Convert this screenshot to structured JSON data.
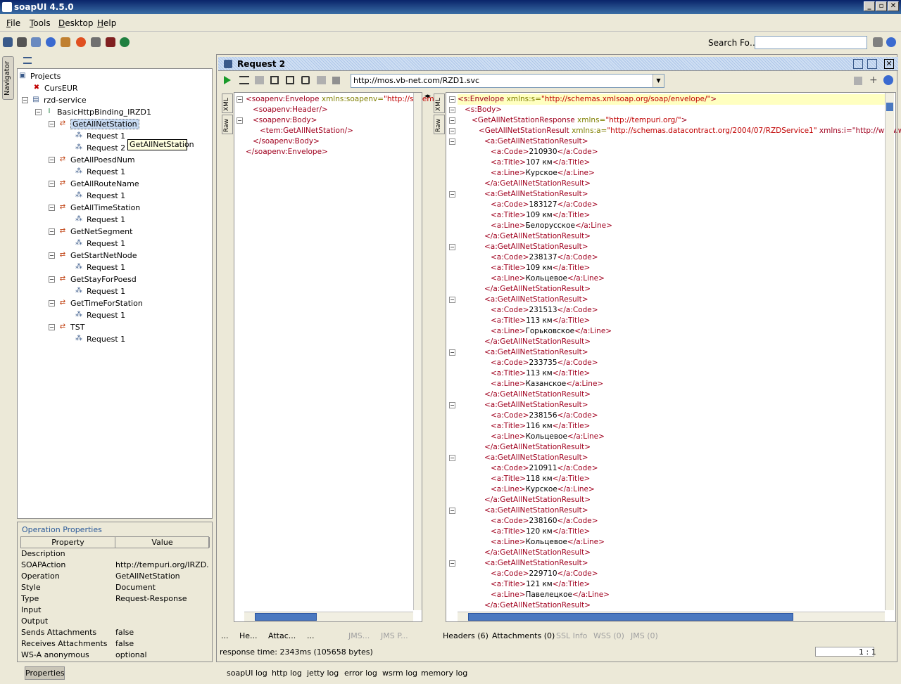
{
  "window": {
    "title": "soapUI 4.5.0"
  },
  "menu": [
    "File",
    "Tools",
    "Desktop",
    "Help"
  ],
  "toolbar": {
    "search_label": "Search Fo…"
  },
  "navigator_tab": "Navigator",
  "tree": {
    "root": "Projects",
    "projects": [
      {
        "name": "CursEUR"
      },
      {
        "name": "rzd-service"
      }
    ],
    "binding": "BasicHttpBinding_IRZD1",
    "operations": [
      {
        "name": "GetAllNetStation",
        "requests": [
          "Request 1",
          "Request 2"
        ]
      },
      {
        "name": "GetAllPoesdNum",
        "requests": [
          "Request 1"
        ]
      },
      {
        "name": "GetAllRouteName",
        "requests": [
          "Request 1"
        ]
      },
      {
        "name": "GetAllTimeStation",
        "requests": [
          "Request 1"
        ]
      },
      {
        "name": "GetNetSegment",
        "requests": [
          "Request 1"
        ]
      },
      {
        "name": "GetStartNetNode",
        "requests": [
          "Request 1"
        ]
      },
      {
        "name": "GetStayForPoesd",
        "requests": [
          "Request 1"
        ]
      },
      {
        "name": "GetTimeForStation",
        "requests": [
          "Request 1"
        ]
      },
      {
        "name": "TST",
        "requests": [
          "Request 1"
        ]
      }
    ],
    "tooltip": "GetAllNetStation"
  },
  "properties": {
    "title": "Operation Properties",
    "col_property": "Property",
    "col_value": "Value",
    "rows": [
      [
        "Description",
        ""
      ],
      [
        "SOAPAction",
        "http://tempuri.org/IRZD..."
      ],
      [
        "Operation",
        "GetAllNetStation"
      ],
      [
        "Style",
        "Document"
      ],
      [
        "Type",
        "Request-Response"
      ],
      [
        "Input",
        ""
      ],
      [
        "Output",
        ""
      ],
      [
        "Sends Attachments",
        "false"
      ],
      [
        "Receives Attachments",
        "false"
      ],
      [
        "WS-A anonymous",
        "optional"
      ]
    ],
    "button": "Properties"
  },
  "request": {
    "title": "Request 2",
    "url": "http://mos.vb-net.com/RZD1.svc",
    "side_tabs": [
      "XML",
      "Raw"
    ],
    "lines": [
      {
        "indent": 0,
        "tag": "<soapenv:Envelope",
        "an": " xmlns:soapenv=",
        "av": "\"http://schem",
        "end": ""
      },
      {
        "indent": 1,
        "tag": "<soapenv:Header/>",
        "an": "",
        "av": "",
        "end": ""
      },
      {
        "indent": 1,
        "tag": "<soapenv:Body>",
        "an": "",
        "av": "",
        "end": ""
      },
      {
        "indent": 2,
        "tag": "<tem:GetAllNetStation/>",
        "an": "",
        "av": "",
        "end": ""
      },
      {
        "indent": 1,
        "tag": "</soapenv:Body>",
        "an": "",
        "av": "",
        "end": ""
      },
      {
        "indent": 0,
        "tag": "</soapenv:Envelope>",
        "an": "",
        "av": "",
        "end": ""
      }
    ],
    "bottom_tabs": [
      "...",
      "He...",
      "Attac...",
      "...",
      "JMS...",
      "JMS P..."
    ]
  },
  "response": {
    "header_lines": [
      {
        "indent": 0,
        "tag": "<s:Envelope",
        "an": " xmlns:s=",
        "av": "\"http://schemas.xmlsoap.org/soap/envelope/\"",
        "end": ">"
      },
      {
        "indent": 1,
        "tag": "<s:Body>",
        "an": "",
        "av": "",
        "end": ""
      },
      {
        "indent": 2,
        "tag": "<GetAllNetStationResponse",
        "an": " xmlns=",
        "av": "\"http://tempuri.org/\"",
        "end": ">"
      },
      {
        "indent": 3,
        "tag": "<GetAllNetStationResult",
        "an": " xmlns:a=",
        "av": "\"http://schemas.datacontract.org/2004/07/RZDService1\"",
        "end": " xmlns:i=\"http://www.w3.org/2"
      }
    ],
    "results": [
      {
        "code": "210930",
        "title": "107 км",
        "line": "Курское"
      },
      {
        "code": "183127",
        "title": "109 км",
        "line": "Белорусское"
      },
      {
        "code": "238137",
        "title": "109 км",
        "line": "Кольцевое"
      },
      {
        "code": "231513",
        "title": "113 км",
        "line": "Горьковское"
      },
      {
        "code": "233735",
        "title": "113 км",
        "line": "Казанское"
      },
      {
        "code": "238156",
        "title": "116 км",
        "line": "Кольцевое"
      },
      {
        "code": "210911",
        "title": "118 км",
        "line": "Курское"
      },
      {
        "code": "238160",
        "title": "120 км",
        "line": "Кольцевое"
      },
      {
        "code": "229710",
        "title": "121 км",
        "line": "Павелецкое"
      }
    ],
    "bottom_tabs": [
      {
        "label": "Headers (6)",
        "enabled": true
      },
      {
        "label": "Attachments (0)",
        "enabled": true
      },
      {
        "label": "SSL Info",
        "enabled": false
      },
      {
        "label": "WSS (0)",
        "enabled": false
      },
      {
        "label": "JMS (0)",
        "enabled": false
      }
    ]
  },
  "status": {
    "response_time": "response time: 2343ms (105658 bytes)",
    "position": "1 : 1"
  },
  "log_tabs": [
    "soapUI log",
    "http log",
    "jetty log",
    "error log",
    "wsrm log",
    "memory log"
  ],
  "colors": {
    "tag": "#a0001e",
    "attr_name": "#7f7f00",
    "attr_value": "#c00000",
    "selection": "#c6d9f1",
    "highlight_line": "#ffffc0"
  }
}
